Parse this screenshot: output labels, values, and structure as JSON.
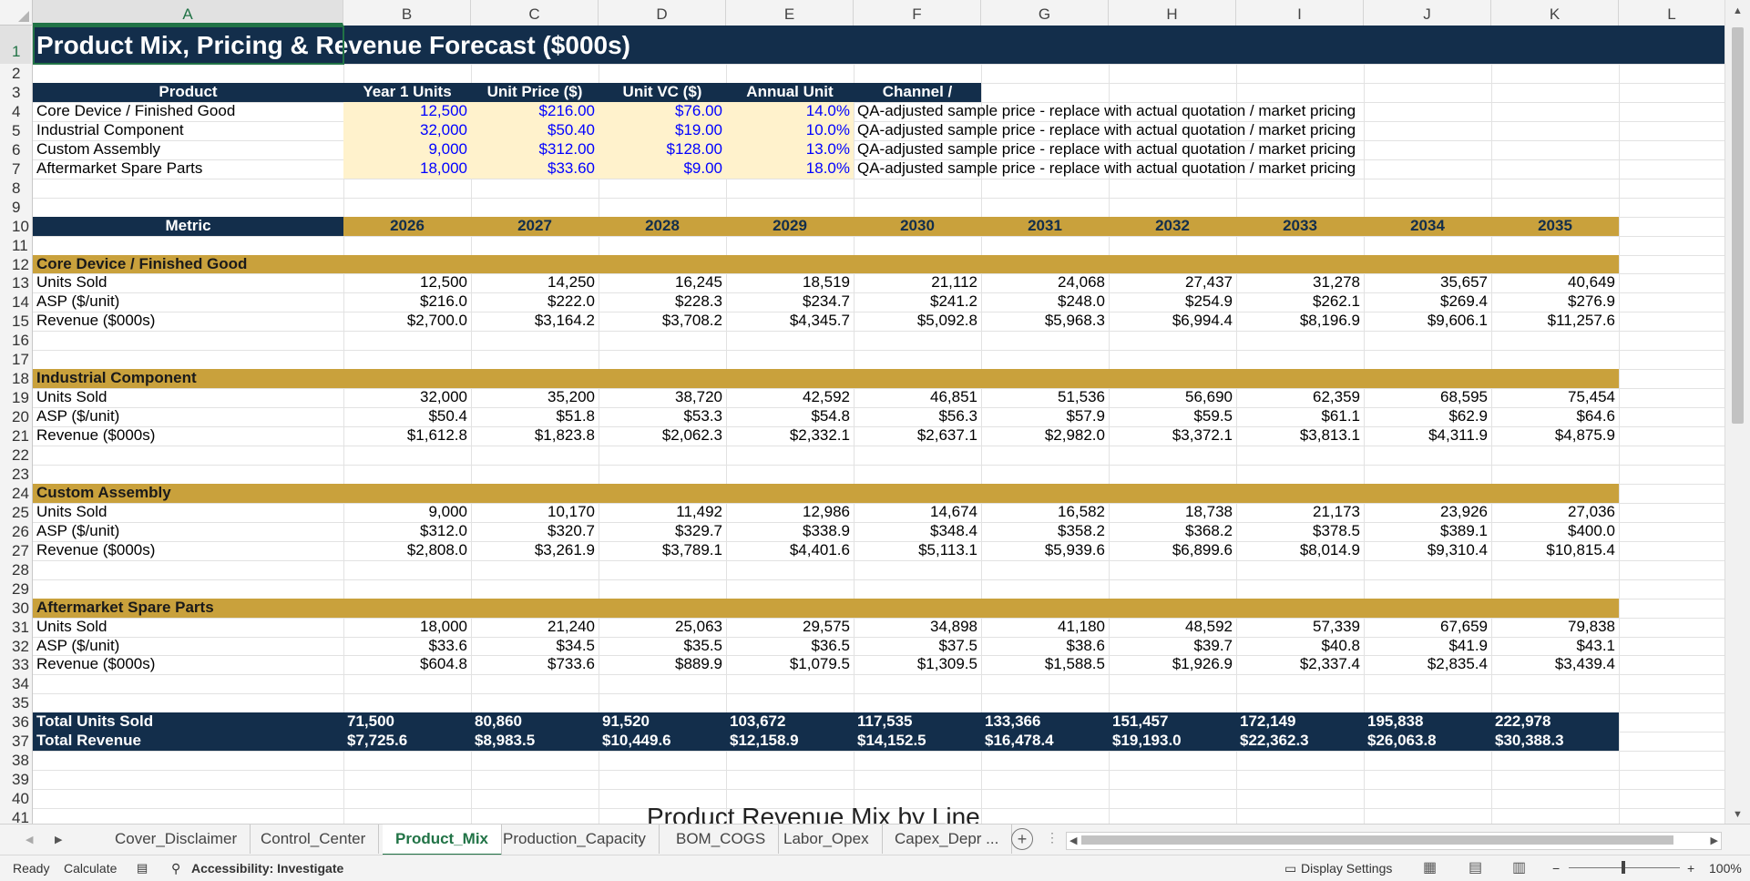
{
  "columns": [
    "A",
    "B",
    "C",
    "D",
    "E",
    "F",
    "G",
    "H",
    "I",
    "J",
    "K",
    "L"
  ],
  "rows": [
    "1",
    "2",
    "3",
    "4",
    "5",
    "6",
    "7",
    "8",
    "9",
    "10",
    "11",
    "12",
    "13",
    "14",
    "15",
    "16",
    "17",
    "18",
    "19",
    "20",
    "21",
    "22",
    "23",
    "24",
    "25",
    "26",
    "27",
    "28",
    "29",
    "30",
    "31",
    "32",
    "33",
    "34",
    "35",
    "36",
    "37",
    "38",
    "39",
    "40",
    "41"
  ],
  "title": "Product Mix, Pricing & Revenue Forecast ($000s)",
  "input_header": [
    "Product",
    "Year 1 Units",
    "Unit Price ($)",
    "Unit VC ($)",
    "Annual Unit",
    "Channel /"
  ],
  "inputs": [
    {
      "product": "Core Device / Finished Good",
      "units": "12,500",
      "price": "$216.00",
      "vc": "$76.00",
      "growth": "14.0%",
      "note": "QA-adjusted sample price - replace with actual quotation / market pricing"
    },
    {
      "product": "Industrial Component",
      "units": "32,000",
      "price": "$50.40",
      "vc": "$19.00",
      "growth": "10.0%",
      "note": "QA-adjusted sample price - replace with actual quotation / market pricing"
    },
    {
      "product": "Custom Assembly",
      "units": "9,000",
      "price": "$312.00",
      "vc": "$128.00",
      "growth": "13.0%",
      "note": "QA-adjusted sample price - replace with actual quotation / market pricing"
    },
    {
      "product": "Aftermarket Spare Parts",
      "units": "18,000",
      "price": "$33.60",
      "vc": "$9.00",
      "growth": "18.0%",
      "note": "QA-adjusted sample price - replace with actual quotation / market pricing"
    }
  ],
  "metric_label": "Metric",
  "years": [
    "2026",
    "2027",
    "2028",
    "2029",
    "2030",
    "2031",
    "2032",
    "2033",
    "2034",
    "2035"
  ],
  "sections": [
    {
      "name": "Core Device / Finished Good",
      "rows": [
        {
          "label": "Units Sold",
          "values": [
            "12,500",
            "14,250",
            "16,245",
            "18,519",
            "21,112",
            "24,068",
            "27,437",
            "31,278",
            "35,657",
            "40,649"
          ]
        },
        {
          "label": "ASP ($/unit)",
          "values": [
            "$216.0",
            "$222.0",
            "$228.3",
            "$234.7",
            "$241.2",
            "$248.0",
            "$254.9",
            "$262.1",
            "$269.4",
            "$276.9"
          ]
        },
        {
          "label": "Revenue ($000s)",
          "values": [
            "$2,700.0",
            "$3,164.2",
            "$3,708.2",
            "$4,345.7",
            "$5,092.8",
            "$5,968.3",
            "$6,994.4",
            "$8,196.9",
            "$9,606.1",
            "$11,257.6"
          ]
        }
      ]
    },
    {
      "name": "Industrial Component",
      "rows": [
        {
          "label": "Units Sold",
          "values": [
            "32,000",
            "35,200",
            "38,720",
            "42,592",
            "46,851",
            "51,536",
            "56,690",
            "62,359",
            "68,595",
            "75,454"
          ]
        },
        {
          "label": "ASP ($/unit)",
          "values": [
            "$50.4",
            "$51.8",
            "$53.3",
            "$54.8",
            "$56.3",
            "$57.9",
            "$59.5",
            "$61.1",
            "$62.9",
            "$64.6"
          ]
        },
        {
          "label": "Revenue ($000s)",
          "values": [
            "$1,612.8",
            "$1,823.8",
            "$2,062.3",
            "$2,332.1",
            "$2,637.1",
            "$2,982.0",
            "$3,372.1",
            "$3,813.1",
            "$4,311.9",
            "$4,875.9"
          ]
        }
      ]
    },
    {
      "name": "Custom Assembly",
      "rows": [
        {
          "label": "Units Sold",
          "values": [
            "9,000",
            "10,170",
            "11,492",
            "12,986",
            "14,674",
            "16,582",
            "18,738",
            "21,173",
            "23,926",
            "27,036"
          ]
        },
        {
          "label": "ASP ($/unit)",
          "values": [
            "$312.0",
            "$320.7",
            "$329.7",
            "$338.9",
            "$348.4",
            "$358.2",
            "$368.2",
            "$378.5",
            "$389.1",
            "$400.0"
          ]
        },
        {
          "label": "Revenue ($000s)",
          "values": [
            "$2,808.0",
            "$3,261.9",
            "$3,789.1",
            "$4,401.6",
            "$5,113.1",
            "$5,939.6",
            "$6,899.6",
            "$8,014.9",
            "$9,310.4",
            "$10,815.4"
          ]
        }
      ]
    },
    {
      "name": "Aftermarket Spare Parts",
      "rows": [
        {
          "label": "Units Sold",
          "values": [
            "18,000",
            "21,240",
            "25,063",
            "29,575",
            "34,898",
            "41,180",
            "48,592",
            "57,339",
            "67,659",
            "79,838"
          ]
        },
        {
          "label": "ASP ($/unit)",
          "values": [
            "$33.6",
            "$34.5",
            "$35.5",
            "$36.5",
            "$37.5",
            "$38.6",
            "$39.7",
            "$40.8",
            "$41.9",
            "$43.1"
          ]
        },
        {
          "label": "Revenue ($000s)",
          "values": [
            "$604.8",
            "$733.6",
            "$889.9",
            "$1,079.5",
            "$1,309.5",
            "$1,588.5",
            "$1,926.9",
            "$2,337.4",
            "$2,835.4",
            "$3,439.4"
          ]
        }
      ]
    }
  ],
  "totals": [
    {
      "label": "Total Units Sold",
      "values": [
        "71,500",
        "80,860",
        "91,520",
        "103,672",
        "117,535",
        "133,366",
        "151,457",
        "172,149",
        "195,838",
        "222,978"
      ]
    },
    {
      "label": "Total Revenue",
      "values": [
        "$7,725.6",
        "$8,983.5",
        "$10,449.6",
        "$12,158.9",
        "$14,152.5",
        "$16,478.4",
        "$19,193.0",
        "$22,362.3",
        "$26,063.8",
        "$30,388.3"
      ]
    }
  ],
  "chart_title": "Product Revenue Mix by Line",
  "sheet_tabs": [
    "Cover_Disclaimer",
    "Control_Center",
    "Product_Mix",
    "Production_Capacity",
    "BOM_COGS",
    "Labor_Opex",
    "Capex_Depr ..."
  ],
  "active_tab": "Product_Mix",
  "status": {
    "ready": "Ready",
    "calculate": "Calculate",
    "accessibility": "Accessibility: Investigate",
    "display_settings": "Display Settings",
    "zoom": "100%"
  },
  "colors": {
    "navy": "#132e4b",
    "gold": "#c9a13c",
    "input_fill": "#fff2cc",
    "excel_green": "#217346"
  }
}
